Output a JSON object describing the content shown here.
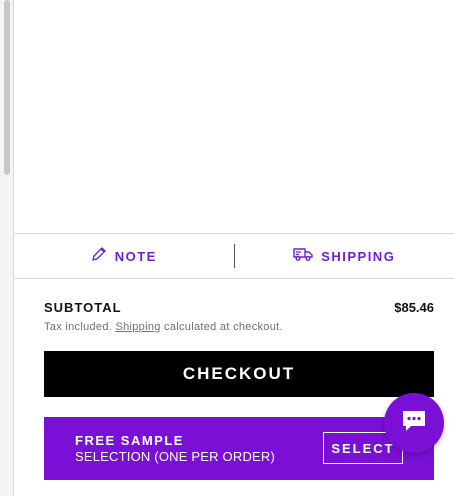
{
  "colors": {
    "accent": "#6d1fd6",
    "banner": "#7a0fd6",
    "checkout_bg": "#000000",
    "muted_text": "#707070"
  },
  "tabs": [
    {
      "label": "NOTE",
      "icon": "pencil-icon"
    },
    {
      "label": "SHIPPING",
      "icon": "truck-icon"
    }
  ],
  "summary": {
    "subtotal_label": "SUBTOTAL",
    "subtotal_amount": "$85.46",
    "tax_prefix": "Tax included.",
    "shipping_link": "Shipping",
    "tax_suffix": "calculated at checkout."
  },
  "checkout": {
    "label": "CHECKOUT"
  },
  "free_sample": {
    "title": "FREE SAMPLE",
    "subtitle": "SELECTION (ONE PER ORDER)",
    "button_label": "SELECT"
  },
  "chat": {
    "icon": "chat-icon"
  }
}
